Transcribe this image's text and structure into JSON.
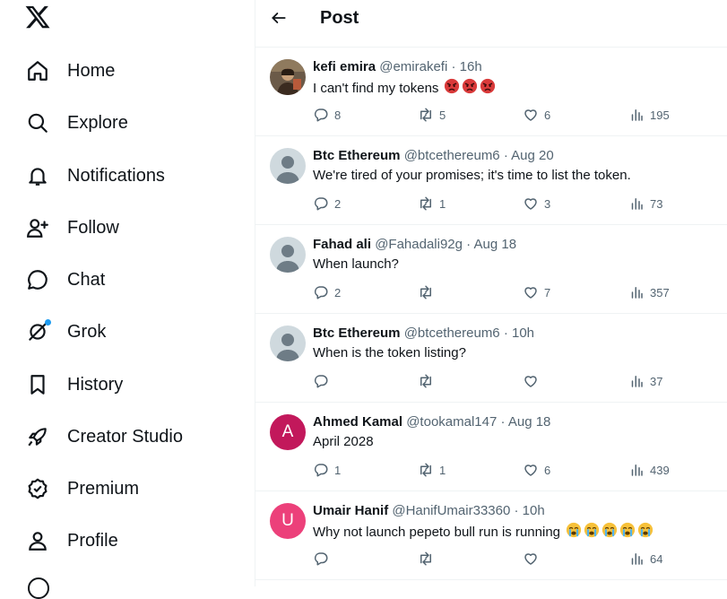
{
  "sidebar": {
    "logo": "x-logo-icon",
    "items": [
      {
        "label": "Home",
        "icon": "home-icon"
      },
      {
        "label": "Explore",
        "icon": "search-icon"
      },
      {
        "label": "Notifications",
        "icon": "bell-icon"
      },
      {
        "label": "Follow",
        "icon": "follow-icon"
      },
      {
        "label": "Chat",
        "icon": "chat-icon"
      },
      {
        "label": "Grok",
        "icon": "grok-icon"
      },
      {
        "label": "History",
        "icon": "bookmark-icon"
      },
      {
        "label": "Creator Studio",
        "icon": "rocket-icon"
      },
      {
        "label": "Premium",
        "icon": "verified-badge-icon"
      },
      {
        "label": "Profile",
        "icon": "person-icon"
      }
    ]
  },
  "header": {
    "title": "Post",
    "back_icon": "back-arrow-icon"
  },
  "replies": [
    {
      "name": "kefi emira",
      "handle": "@emirakefi",
      "time": "16h",
      "text": "I can't find my tokens",
      "emoji": "angry-face x3",
      "replies": "8",
      "reposts": "5",
      "likes": "6",
      "views": "195",
      "avatar": "photo"
    },
    {
      "name": "Btc Ethereum",
      "handle": "@btcethereum6",
      "time": "Aug 20",
      "text": "We're tired of your promises; it's time to list the token.",
      "replies": "2",
      "reposts": "1",
      "likes": "3",
      "views": "73",
      "avatar": "default"
    },
    {
      "name": "Fahad ali",
      "handle": "@Fahadali92g",
      "time": "Aug 18",
      "text": "When launch?",
      "replies": "2",
      "reposts": "",
      "likes": "7",
      "views": "357",
      "avatar": "default"
    },
    {
      "name": "Btc Ethereum",
      "handle": "@btcethereum6",
      "time": "10h",
      "text": "When is the token listing?",
      "replies": "",
      "reposts": "",
      "likes": "",
      "views": "37",
      "avatar": "default"
    },
    {
      "name": "Ahmed Kamal",
      "handle": "@tookamal147",
      "time": "Aug 18",
      "text": "April 2028",
      "replies": "1",
      "reposts": "1",
      "likes": "6",
      "views": "439",
      "avatar": "letter",
      "letter": "A",
      "avatar_color": "#c2185b"
    },
    {
      "name": "Umair Hanif",
      "handle": "@HanifUmair33360",
      "time": "10h",
      "text": "Why not launch pepeto bull run is running",
      "emoji": "crying-face x5",
      "replies": "",
      "reposts": "",
      "likes": "",
      "views": "64",
      "avatar": "letter",
      "letter": "U",
      "avatar_color": "#ec407a"
    }
  ],
  "colors": {
    "accent": "#1d9bf0",
    "text": "#0f1419",
    "muted": "#536471",
    "border": "#eff3f4"
  }
}
